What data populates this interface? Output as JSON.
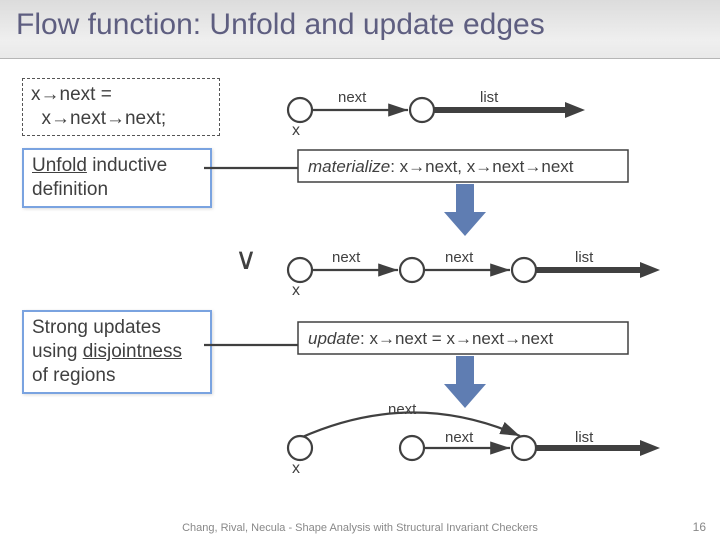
{
  "title": "Flow function: Unfold and update edges",
  "code": {
    "line1": "x→next =",
    "line2": "  x→next→next;"
  },
  "unfold": {
    "word": "Unfold",
    "rest": " inductive definition"
  },
  "strong": {
    "l1": "Strong updates",
    "l2a": "using ",
    "l2b": "disjointness",
    "l3": "of regions"
  },
  "vee": "∨",
  "labels": {
    "x": "x",
    "next": "next",
    "list": "list"
  },
  "step1": {
    "name": "materialize",
    "expr": "x→next, x→next→next"
  },
  "step2": {
    "name": "update",
    "expr": "x→next = x→next→next"
  },
  "footer": "Chang, Rival, Necula - Shape Analysis with Structural Invariant Checkers",
  "page": "16"
}
